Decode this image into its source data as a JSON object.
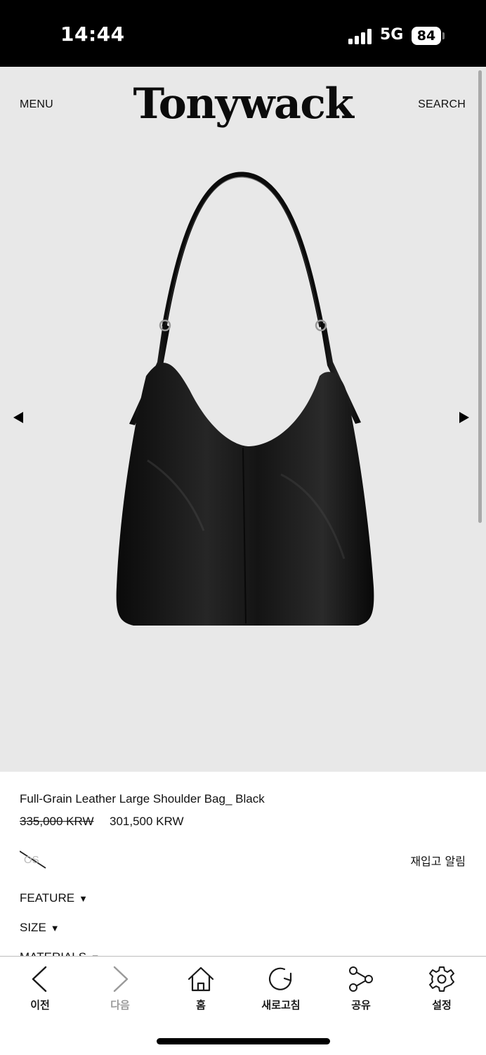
{
  "status_bar": {
    "time": "14:44",
    "network": "5G",
    "battery": "84"
  },
  "header": {
    "menu_label": "MENU",
    "logo": "Tonywack",
    "search_label": "SEARCH"
  },
  "gallery": {
    "prev_icon": "triangle-left-icon",
    "next_icon": "triangle-right-icon",
    "background": "#e8e8e8"
  },
  "product": {
    "name": "Full-Grain Leather Large Shoulder Bag_ Black",
    "original_price": "335,000 KRW",
    "sale_price": "301,500 KRW",
    "option": {
      "label": "OS",
      "sold_out": true
    },
    "restock_label": "재입고 알림"
  },
  "accordions": [
    {
      "label": "FEATURE"
    },
    {
      "label": "SIZE"
    },
    {
      "label": "MATERIALS"
    }
  ],
  "toolbar": {
    "items": [
      {
        "label": "이전",
        "icon": "chevron-left-icon",
        "enabled": true
      },
      {
        "label": "다음",
        "icon": "chevron-right-icon",
        "enabled": false
      },
      {
        "label": "홈",
        "icon": "home-icon",
        "enabled": true
      },
      {
        "label": "새로고침",
        "icon": "refresh-icon",
        "enabled": true
      },
      {
        "label": "공유",
        "icon": "share-icon",
        "enabled": true
      },
      {
        "label": "설정",
        "icon": "gear-icon",
        "enabled": true
      }
    ]
  }
}
